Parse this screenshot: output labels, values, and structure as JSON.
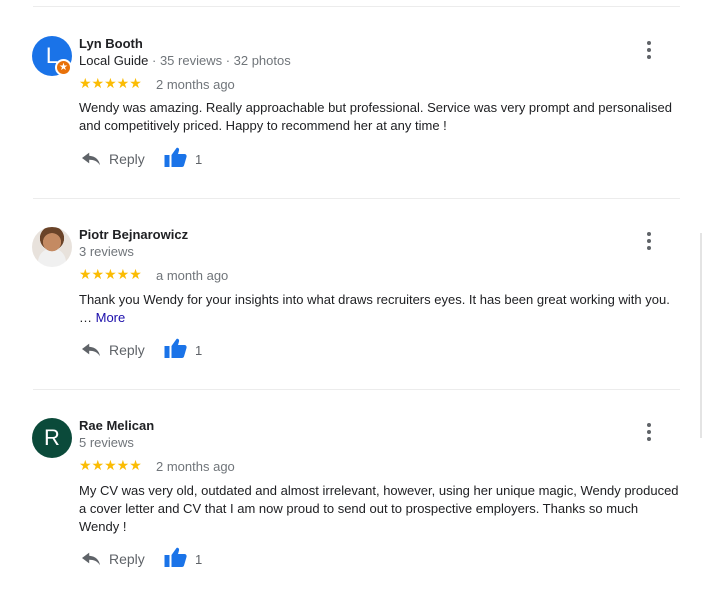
{
  "reviews": [
    {
      "avatar_letter": "L",
      "avatar_color": "#1a73e8",
      "name": "Lyn Booth",
      "local_guide": "Local Guide",
      "stats": " · 35 reviews · 32 photos",
      "stars": "★★★★★",
      "time": "2 months ago",
      "text": "Wendy was amazing. Really approachable but professional. Service was very prompt and personalised and competitively priced. Happy to recommend her at any time !",
      "reply_label": "Reply",
      "likes": "1"
    },
    {
      "avatar_letter": "",
      "name": "Piotr Bejnarowicz",
      "stats": "3 reviews",
      "stars": "★★★★★",
      "time": "a month ago",
      "text": "Thank you Wendy for your insights into what draws recruiters eyes. It has been great working with you.",
      "ellipsis": "… ",
      "more_label": "More",
      "reply_label": "Reply",
      "likes": "1"
    },
    {
      "avatar_letter": "R",
      "avatar_color": "#0b4a3a",
      "name": "Rae Melican",
      "stats": "5 reviews",
      "stars": "★★★★★",
      "time": "2 months ago",
      "text": "My CV was very old, outdated and almost irrelevant, however, using her unique magic, Wendy produced a cover letter and CV that I am now proud to send out to prospective employers. Thanks so much Wendy !",
      "reply_label": "Reply",
      "likes": "1"
    }
  ],
  "icons": {
    "reply": "reply-arrow-icon",
    "like": "thumbs-up-icon",
    "menu": "more-vert-icon",
    "badge": "local-guide-star-icon"
  },
  "colors": {
    "star": "#fbbc04",
    "like": "#1a73e8",
    "link": "#1a0dab",
    "badge": "#e8710a"
  }
}
